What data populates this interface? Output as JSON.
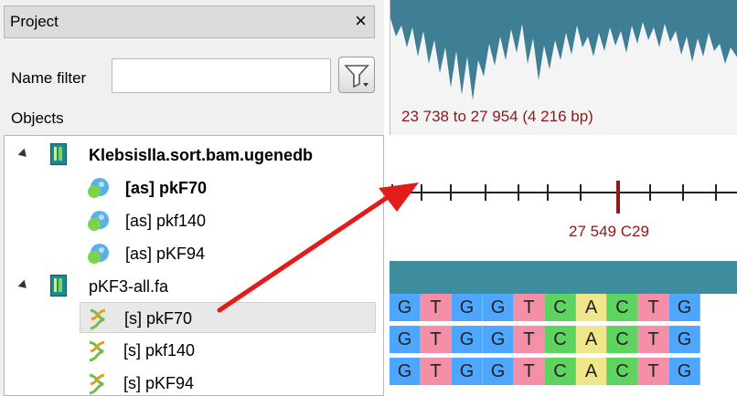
{
  "project_panel": {
    "title": "Project",
    "close_glyph": "×",
    "name_filter_label": "Name filter",
    "name_filter_value": "",
    "filter_icon": "funnel-filter-icon",
    "objects_label": "Objects"
  },
  "tree": {
    "docs": [
      {
        "label": "Klebsislla.sort.bam.ugenedb",
        "bold": true,
        "icon": "document-icon",
        "items": [
          {
            "label": "[as] pkF70",
            "bold": true,
            "icon": "assembly-icon"
          },
          {
            "label": "[as] pkf140",
            "bold": false,
            "icon": "assembly-icon"
          },
          {
            "label": "[as] pKF94",
            "bold": false,
            "icon": "assembly-icon"
          }
        ]
      },
      {
        "label": "pKF3-all.fa",
        "bold": false,
        "icon": "document-icon",
        "items": [
          {
            "label": "[s] pkF70",
            "selected": true,
            "icon": "sequence-icon"
          },
          {
            "label": "[s] pkf140",
            "selected": false,
            "icon": "sequence-icon"
          },
          {
            "label": "[s] pKF94",
            "selected": false,
            "icon": "sequence-icon"
          }
        ]
      }
    ]
  },
  "assembly_view": {
    "range_text": "23 738 to 27 954 (4 216 bp)",
    "position_label": "27 549 C29",
    "sequence_rows": [
      [
        "G",
        "T",
        "G",
        "G",
        "T",
        "C",
        "A",
        "C",
        "T",
        "G"
      ],
      [
        "G",
        "T",
        "G",
        "G",
        "T",
        "C",
        "A",
        "C",
        "T",
        "G"
      ],
      [
        "G",
        "T",
        "G",
        "G",
        "T",
        "C",
        "A",
        "C",
        "T",
        "G"
      ]
    ],
    "base_colors": {
      "G": "#4da6ff",
      "T": "#f48fa8",
      "C": "#5fd35f",
      "A": "#f0e68c"
    },
    "annotation": "red-arrow"
  }
}
